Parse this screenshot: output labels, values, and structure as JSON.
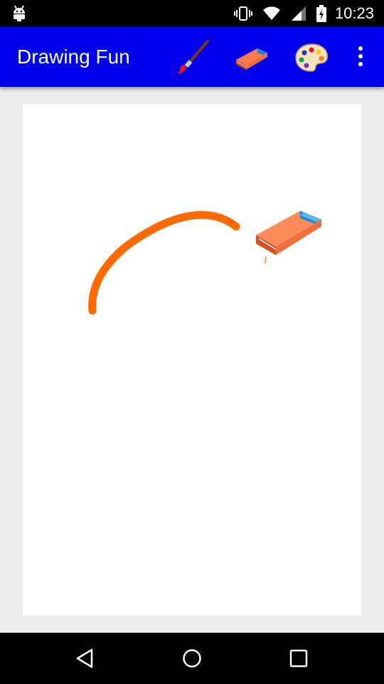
{
  "status_bar": {
    "time": "10:23",
    "icons": [
      "android-debug-icon",
      "vibrate-icon",
      "wifi-icon",
      "signal-icon",
      "battery-charging-icon"
    ]
  },
  "app_bar": {
    "title": "Drawing Fun",
    "actions": [
      "paintbrush-icon",
      "eraser-icon",
      "palette-icon",
      "overflow-menu-icon"
    ],
    "color": "#0000ee"
  },
  "canvas": {
    "background": "#ffffff",
    "stroke_color": "#ff6a00",
    "cursor_tool": "eraser-icon"
  },
  "nav_bar": {
    "buttons": [
      "back-icon",
      "home-icon",
      "recents-icon"
    ]
  }
}
